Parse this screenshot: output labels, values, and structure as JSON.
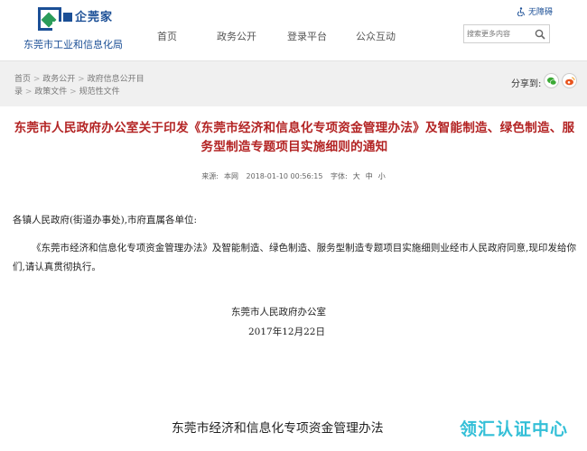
{
  "header": {
    "logo_mark": "企莞家",
    "logo_subtitle": "东莞市工业和信息化局",
    "accessibility": "无障碍",
    "nav": [
      {
        "label": "首页"
      },
      {
        "label": "政务公开"
      },
      {
        "label": "登录平台"
      },
      {
        "label": "公众互动"
      }
    ],
    "search": {
      "placeholder": "搜索更多内容"
    }
  },
  "breadcrumb": {
    "items": [
      "首页",
      "政务公开",
      "政府信息公开目录",
      "政策文件",
      "规范性文件"
    ]
  },
  "share": {
    "label": "分享到:",
    "icons": [
      "wechat-icon",
      "weibo-icon"
    ]
  },
  "article": {
    "title": "东莞市人民政府办公室关于印发《东莞市经济和信息化专项资金管理办法》及智能制造、绿色制造、服务型制造专题项目实施细则的通知",
    "meta": {
      "source_label": "来源:",
      "source": "本网",
      "datetime": "2018-01-10 00:56:15",
      "font_label": "字体:",
      "size_large": "大",
      "size_medium": "中",
      "size_small": "小"
    },
    "salutation": "各镇人民政府(街道办事处),市府直属各单位:",
    "paragraph": "《东莞市经济和信息化专项资金管理办法》及智能制造、绿色制造、服务型制造专题项目实施细则业经市人民政府同意,现印发给你们,请认真贯彻执行。",
    "signature_org": "东莞市人民政府办公室",
    "signature_date": "2017年12月22日",
    "subtitle": "东莞市经济和信息化专项资金管理办法"
  },
  "watermark": "领汇认证中心",
  "colors": {
    "title_red": "#b32424",
    "brand_blue": "#1b4f96",
    "watermark_cyan": "#1db9d3",
    "wechat_green": "#3ba935",
    "weibo_orange": "#e8541e"
  }
}
